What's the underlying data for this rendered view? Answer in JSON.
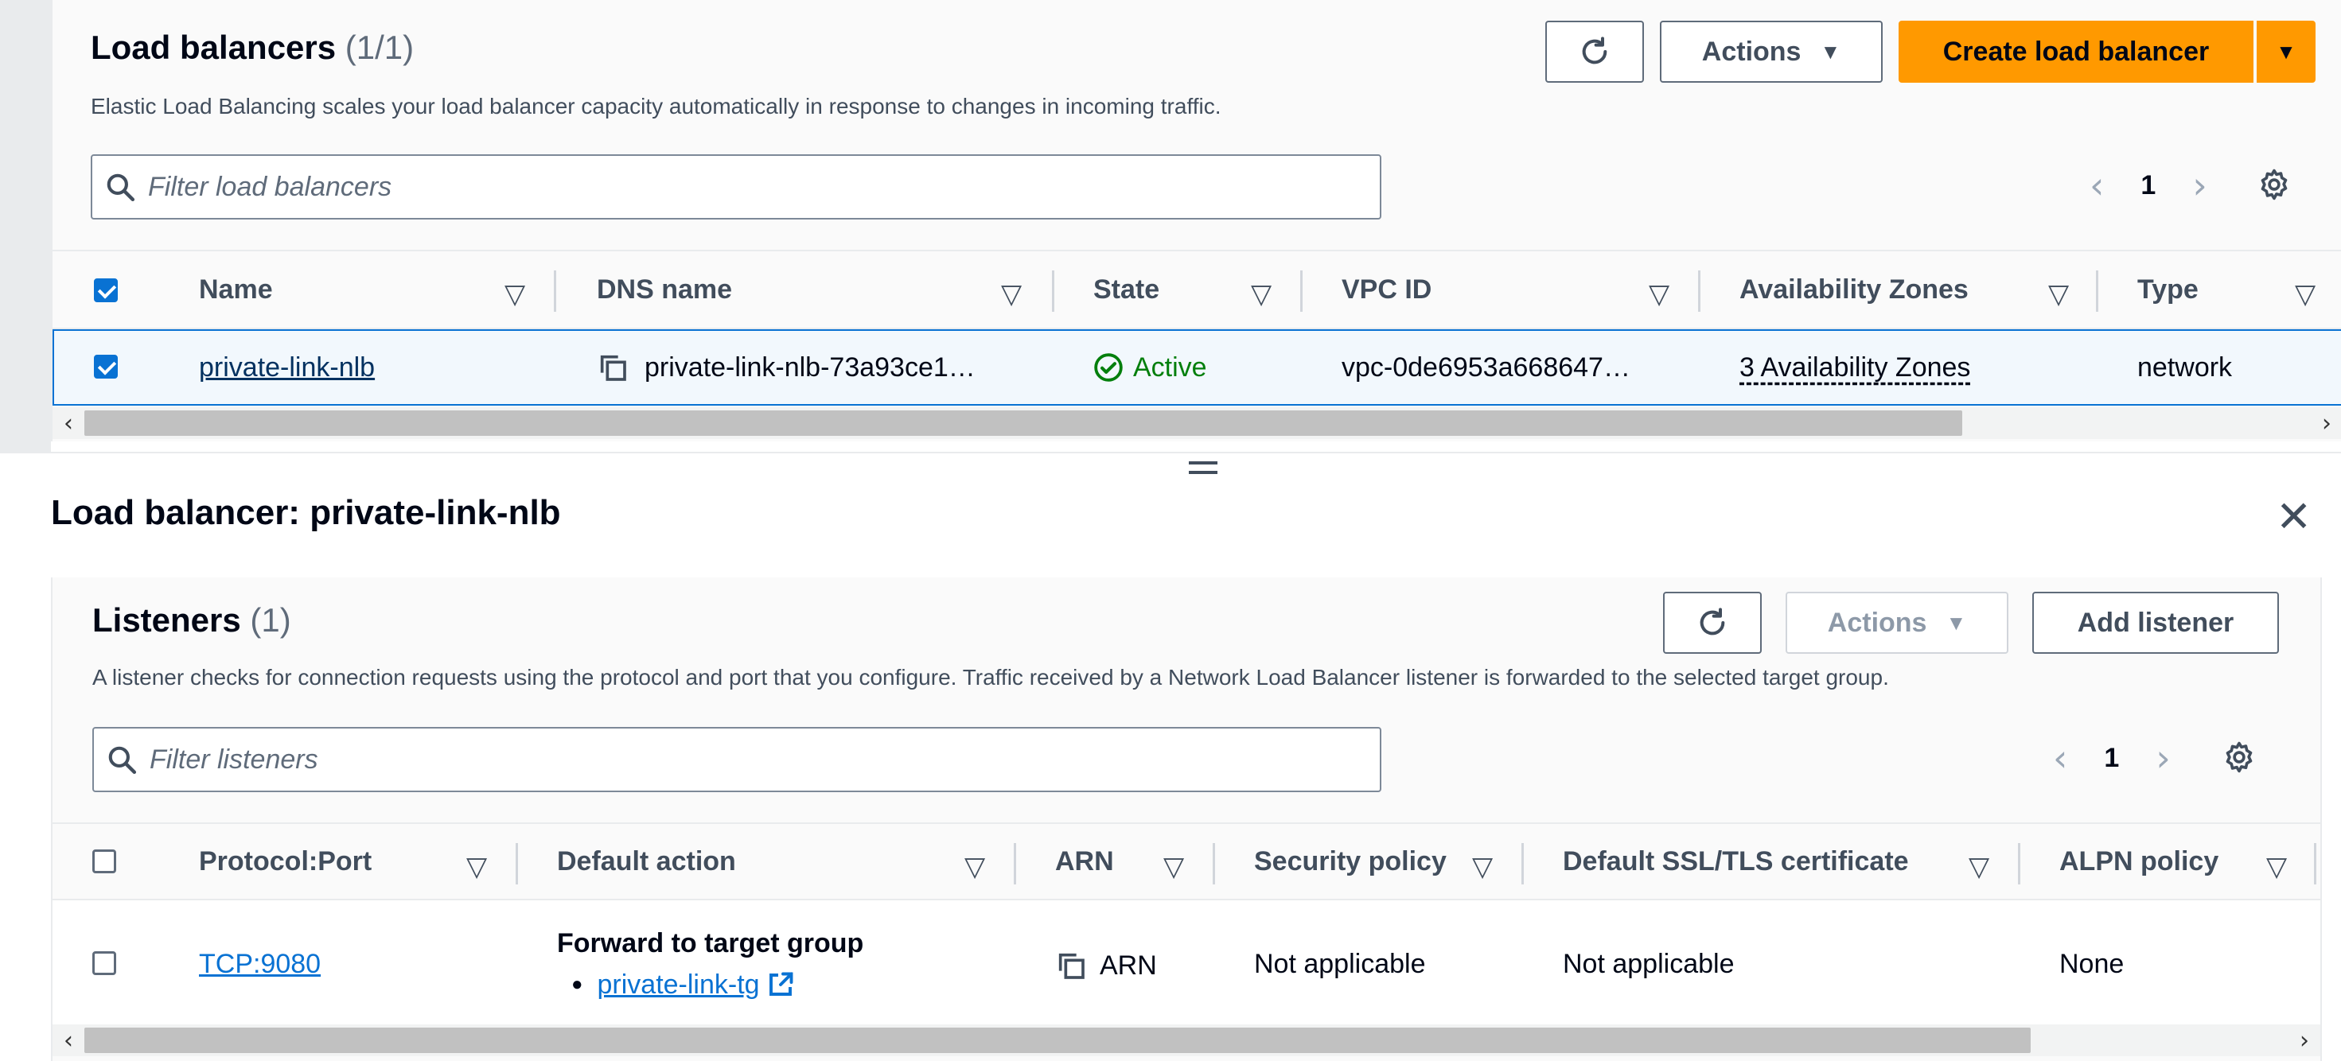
{
  "load_balancers": {
    "title": "Load balancers",
    "count": "(1/1)",
    "description": "Elastic Load Balancing scales your load balancer capacity automatically in response to changes in incoming traffic.",
    "actions_label": "Actions",
    "create_label": "Create load balancer",
    "search_placeholder": "Filter load balancers",
    "page": "1",
    "columns": [
      "Name",
      "DNS name",
      "State",
      "VPC ID",
      "Availability Zones",
      "Type"
    ],
    "row": {
      "name": "private-link-nlb",
      "dns": "private-link-nlb-73a93ce1…",
      "state": "Active",
      "vpc": "vpc-0de6953a668647…",
      "azs": "3 Availability Zones",
      "type": "network"
    }
  },
  "details": {
    "title": "Load balancer: private-link-nlb"
  },
  "listeners": {
    "title": "Listeners",
    "count": "(1)",
    "description": "A listener checks for connection requests using the protocol and port that you configure. Traffic received by a Network Load Balancer listener is forwarded to the selected target group.",
    "actions_label": "Actions",
    "add_label": "Add listener",
    "search_placeholder": "Filter listeners",
    "page": "1",
    "columns": [
      "Protocol:Port",
      "Default action",
      "ARN",
      "Security policy",
      "Default SSL/TLS certificate",
      "ALPN policy"
    ],
    "row": {
      "protocol_port": "TCP:9080",
      "default_action": "Forward to target group",
      "target_group": "private-link-tg",
      "arn": "ARN",
      "security_policy": "Not applicable",
      "certificate": "Not applicable",
      "alpn": "None"
    }
  },
  "colors": {
    "primary": "#ff9900",
    "link": "#0972d3",
    "success": "#037f0c",
    "selected_row": "#f2f8fd"
  }
}
